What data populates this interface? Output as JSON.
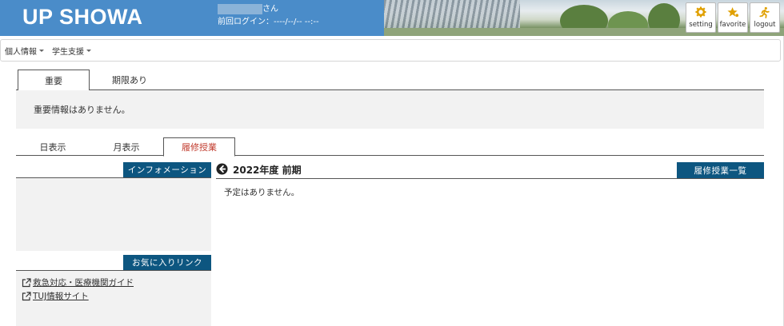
{
  "header": {
    "logo": "UP SHOWA",
    "user_suffix": "さん",
    "last_login": "前回ログイン：----/--/-- --:--",
    "buttons": [
      {
        "label": "setting",
        "icon": "gear-icon"
      },
      {
        "label": "favorite",
        "icon": "star-icon"
      },
      {
        "label": "logout",
        "icon": "running-person-icon"
      }
    ]
  },
  "menu": {
    "items": [
      {
        "label": "個人情報"
      },
      {
        "label": "学生支援"
      }
    ]
  },
  "notice_tabs": {
    "tabs": [
      {
        "label": "重要"
      },
      {
        "label": "期限あり"
      }
    ],
    "active": "重要",
    "message": "重要情報はありません。"
  },
  "view_tabs": {
    "tabs": [
      {
        "label": "日表示"
      },
      {
        "label": "月表示"
      },
      {
        "label": "履修授業"
      }
    ],
    "active": "履修授業"
  },
  "sidebar": {
    "info_title": "インフォメーション",
    "favorites_title": "お気に入りリンク",
    "links": [
      {
        "label": "救急対応・医療機関ガイド"
      },
      {
        "label": "TUJ情報サイト"
      }
    ]
  },
  "main": {
    "term_title": "2022年度 前期",
    "list_button": "履修授業一覧",
    "empty_message": "予定はありません。"
  },
  "colors": {
    "header_bg": "#4a8cc9",
    "section_head_bg": "#0d5680",
    "active_tab_text": "#c0392b",
    "panel_bg": "#f2f2f2"
  }
}
